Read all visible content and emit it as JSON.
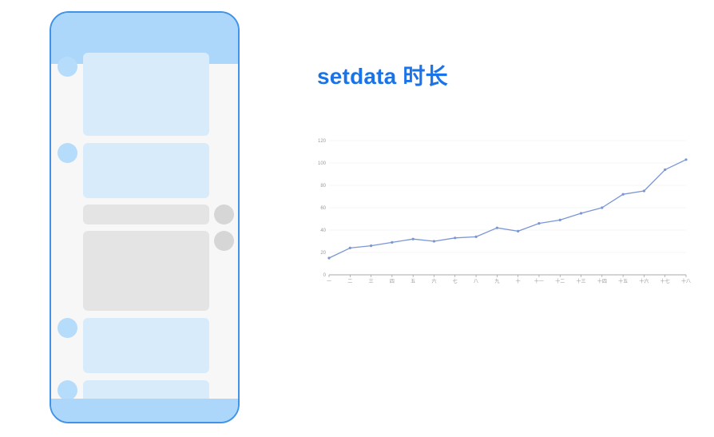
{
  "title": "setdata 时长",
  "colors": {
    "phone_border": "#3f93e8",
    "phone_bar": "#acd7fb",
    "bubble_blue": "#d7ebfb",
    "bubble_gray": "#e4e4e4",
    "title": "#1a73e8",
    "series_line": "#7b96d4"
  },
  "chart_data": {
    "type": "line",
    "categories": [
      "一",
      "二",
      "三",
      "四",
      "五",
      "六",
      "七",
      "八",
      "九",
      "十",
      "十一",
      "十二",
      "十三",
      "十四",
      "十五",
      "十六",
      "十七",
      "十八"
    ],
    "values": [
      15,
      24,
      26,
      29,
      32,
      30,
      33,
      34,
      42,
      39,
      46,
      49,
      55,
      60,
      72,
      75,
      94,
      103
    ],
    "ylim": [
      0,
      120
    ],
    "yticks": [
      0,
      20,
      40,
      60,
      80,
      100,
      120
    ],
    "ytick_labels": [
      "0",
      "20",
      "40",
      "60",
      "80",
      "100",
      "120"
    ],
    "grid": true,
    "legend": "none"
  }
}
